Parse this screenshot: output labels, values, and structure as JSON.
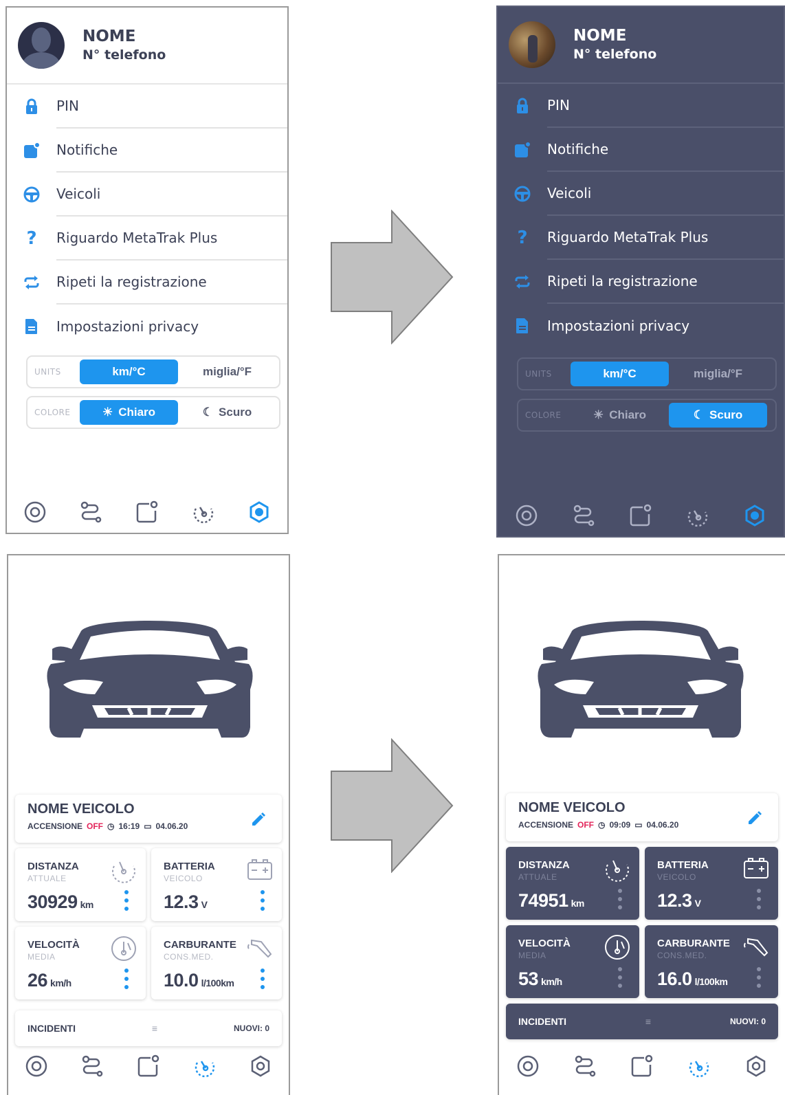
{
  "settings": {
    "name": "NOME",
    "phone": "N° telefono",
    "menu": [
      {
        "label": "PIN",
        "icon": "lock-icon"
      },
      {
        "label": "Notifiche",
        "icon": "notification-icon"
      },
      {
        "label": "Veicoli",
        "icon": "steering-wheel-icon"
      },
      {
        "label": "Riguardo MetaTrak Plus",
        "icon": "question-icon"
      },
      {
        "label": "Ripeti la registrazione",
        "icon": "repeat-icon"
      },
      {
        "label": "Impostazioni privacy",
        "icon": "document-icon"
      }
    ],
    "units_label": "UNITS",
    "units_options": [
      "km/°C",
      "miglia/°F"
    ],
    "color_label": "COLORE",
    "color_options": [
      "Chiaro",
      "Scuro"
    ]
  },
  "vehicle_light": {
    "name": "NOME VEICOLO",
    "ignition_label": "ACCENSIONE",
    "ignition_state": "OFF",
    "time": "16:19",
    "date": "04.06.20",
    "distance_label": "DISTANZA",
    "distance_sub": "ATTUALE",
    "distance_value": "30929",
    "distance_unit": "km",
    "battery_label": "BATTERIA",
    "battery_sub": "VEICOLO",
    "battery_value": "12.3",
    "battery_unit": "V",
    "speed_label": "VELOCITÀ",
    "speed_sub": "MEDIA",
    "speed_value": "26",
    "speed_unit": "km/h",
    "fuel_label": "CARBURANTE",
    "fuel_sub": "CONS.MED.",
    "fuel_value": "10.0",
    "fuel_unit": "l/100km",
    "incidents_label": "INCIDENTI",
    "incidents_new": "NUOVI: 0"
  },
  "vehicle_dark": {
    "name": "NOME VEICOLO",
    "ignition_label": "ACCENSIONE",
    "ignition_state": "OFF",
    "time": "09:09",
    "date": "04.06.20",
    "distance_label": "DISTANZA",
    "distance_sub": "ATTUALE",
    "distance_value": "74951",
    "distance_unit": "km",
    "battery_label": "BATTERIA",
    "battery_sub": "VEICOLO",
    "battery_value": "12.3",
    "battery_unit": "V",
    "speed_label": "VELOCITÀ",
    "speed_sub": "MEDIA",
    "speed_value": "53",
    "speed_unit": "km/h",
    "fuel_label": "CARBURANTE",
    "fuel_sub": "CONS.MED.",
    "fuel_value": "16.0",
    "fuel_unit": "l/100km",
    "incidents_label": "INCIDENTI",
    "incidents_new": "NUOVI: 0"
  },
  "colors": {
    "accent": "#1e95ee",
    "dark_bg": "#4a4f69",
    "off_red": "#e3245a"
  }
}
